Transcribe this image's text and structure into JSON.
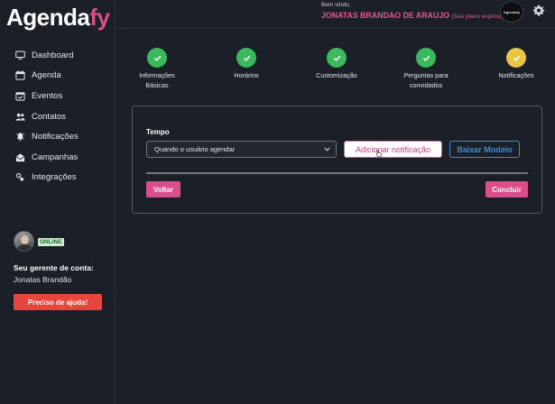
{
  "brand": {
    "logo_main": "Agenda",
    "logo_accent": "fy",
    "accent_color": "#d94f8c"
  },
  "sidebar": {
    "items": [
      {
        "label": "Dashboard",
        "icon": "monitor-icon"
      },
      {
        "label": "Agenda",
        "icon": "calendar-icon"
      },
      {
        "label": "Eventos",
        "icon": "calendar-check-icon"
      },
      {
        "label": "Contatos",
        "icon": "people-icon"
      },
      {
        "label": "Notificações",
        "icon": "bell-icon"
      },
      {
        "label": "Campanhas",
        "icon": "envelope-open-icon"
      },
      {
        "label": "Integrações",
        "icon": "integration-icon"
      }
    ],
    "manager": {
      "status": "ONLINE",
      "title": "Seu gerente de conta:",
      "name": "Jonatas Brandão",
      "help_label": "Preciso de ajuda!"
    }
  },
  "header": {
    "welcome": "Bem vindo,",
    "user_name": "JONATAS BRANDAO DE ARAUJO",
    "plan_status": "(Seu plano expirou)",
    "brand_badge": "Agendafy"
  },
  "stepper": {
    "steps": [
      {
        "label": "Informações Básicas",
        "state": "done"
      },
      {
        "label": "Horários",
        "state": "done"
      },
      {
        "label": "Customização",
        "state": "done"
      },
      {
        "label": "Perguntas para convidados",
        "state": "done"
      },
      {
        "label": "Notificações",
        "state": "active"
      }
    ]
  },
  "form": {
    "tempo_label": "Tempo",
    "tempo_value": "Quando o usuário agendar",
    "add_label": "Adicionar notificação",
    "model_label": "Baixar Modelo",
    "back_label": "Voltar",
    "finish_label": "Concluir"
  },
  "colors": {
    "success": "#3cb95c",
    "active": "#e8c545",
    "pink": "#d94f8c",
    "blue": "#3b8ed1",
    "danger": "#e8453c"
  }
}
